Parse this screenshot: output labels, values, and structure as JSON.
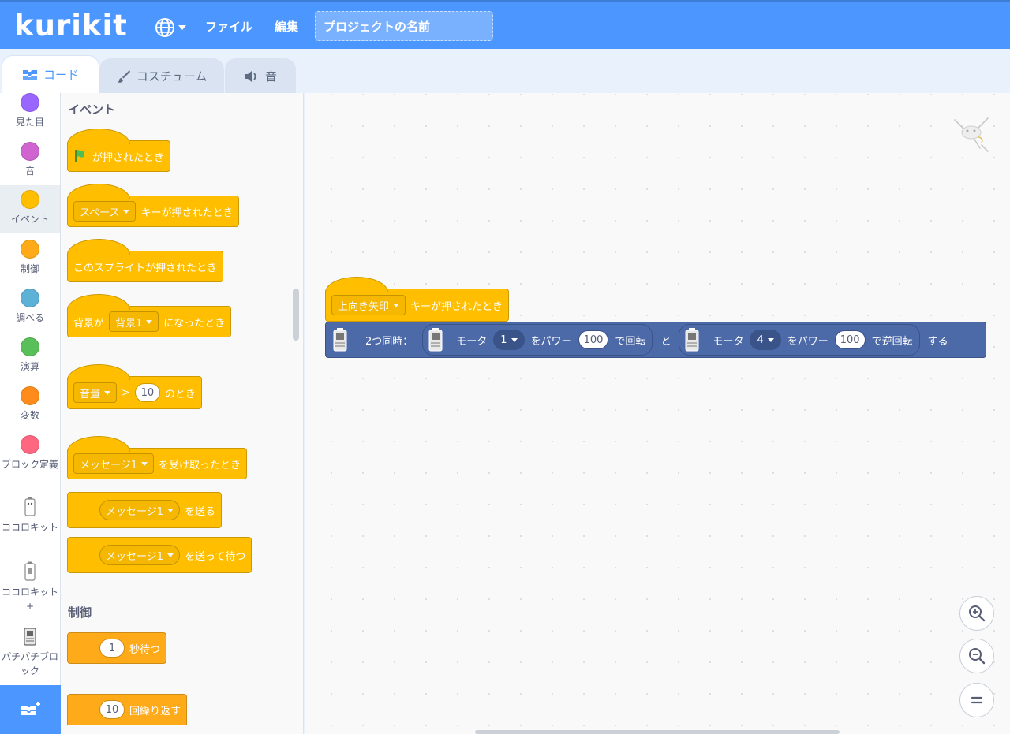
{
  "app": {
    "logo": "kurikit"
  },
  "menu": {
    "file": "ファイル",
    "edit": "編集"
  },
  "project": {
    "title": "プロジェクトの名前"
  },
  "tabs": {
    "code": "コード",
    "costume": "コスチューム",
    "sound": "音"
  },
  "categories": [
    {
      "label": "見た目",
      "color": "#9966ff"
    },
    {
      "label": "音",
      "color": "#cf63cf"
    },
    {
      "label": "イベント",
      "color": "#ffbf00"
    },
    {
      "label": "制御",
      "color": "#ffab19"
    },
    {
      "label": "調べる",
      "color": "#5cb1d6"
    },
    {
      "label": "演算",
      "color": "#59c059"
    },
    {
      "label": "変数",
      "color": "#ff8c1a"
    },
    {
      "label": "ブロック定義",
      "color": "#ff6680"
    },
    {
      "label": "ココロキット"
    },
    {
      "label": "ココロキット+"
    },
    {
      "label": "パチパチブロック"
    }
  ],
  "palette": {
    "events_heading": "イベント",
    "control_heading": "制御",
    "flag_block": "が押されたとき",
    "key_block": {
      "dropdown": "スペース",
      "text": "キーが押されたとき"
    },
    "sprite_clicked": "このスプライトが押されたとき",
    "backdrop_block": {
      "prefix": "背景が",
      "dropdown": "背景1",
      "suffix": "になったとき"
    },
    "greater_block": {
      "dropdown": "音量",
      "op": ">",
      "value": "10",
      "suffix": "のとき"
    },
    "receive_block": {
      "dropdown": "メッセージ1",
      "text": "を受け取ったとき"
    },
    "broadcast_block": {
      "dropdown": "メッセージ1",
      "text": "を送る"
    },
    "broadcast_wait_block": {
      "dropdown": "メッセージ1",
      "text": "を送って待つ"
    },
    "wait_block": {
      "value": "1",
      "text": "秒待つ"
    },
    "repeat_block": {
      "value": "10",
      "text": "回繰り返す"
    }
  },
  "script": {
    "hat": {
      "dropdown": "上向き矢印",
      "text": "キーが押されたとき"
    },
    "motor": {
      "prefix": "2つ同時：",
      "motor_label_1": "モータ",
      "motor_1": "1",
      "power_label_1": "をパワー",
      "power_1": "100",
      "action_1": "で回転",
      "joiner": "と",
      "motor_label_2": "モータ",
      "motor_2": "4",
      "power_label_2": "をパワー",
      "power_2": "100",
      "action_2": "で逆回転",
      "suffix": "する"
    }
  },
  "colors": {
    "accent": "#4c97ff",
    "events": "#ffbf00",
    "control": "#ffab19",
    "motor_block": "#4d6aa8"
  }
}
